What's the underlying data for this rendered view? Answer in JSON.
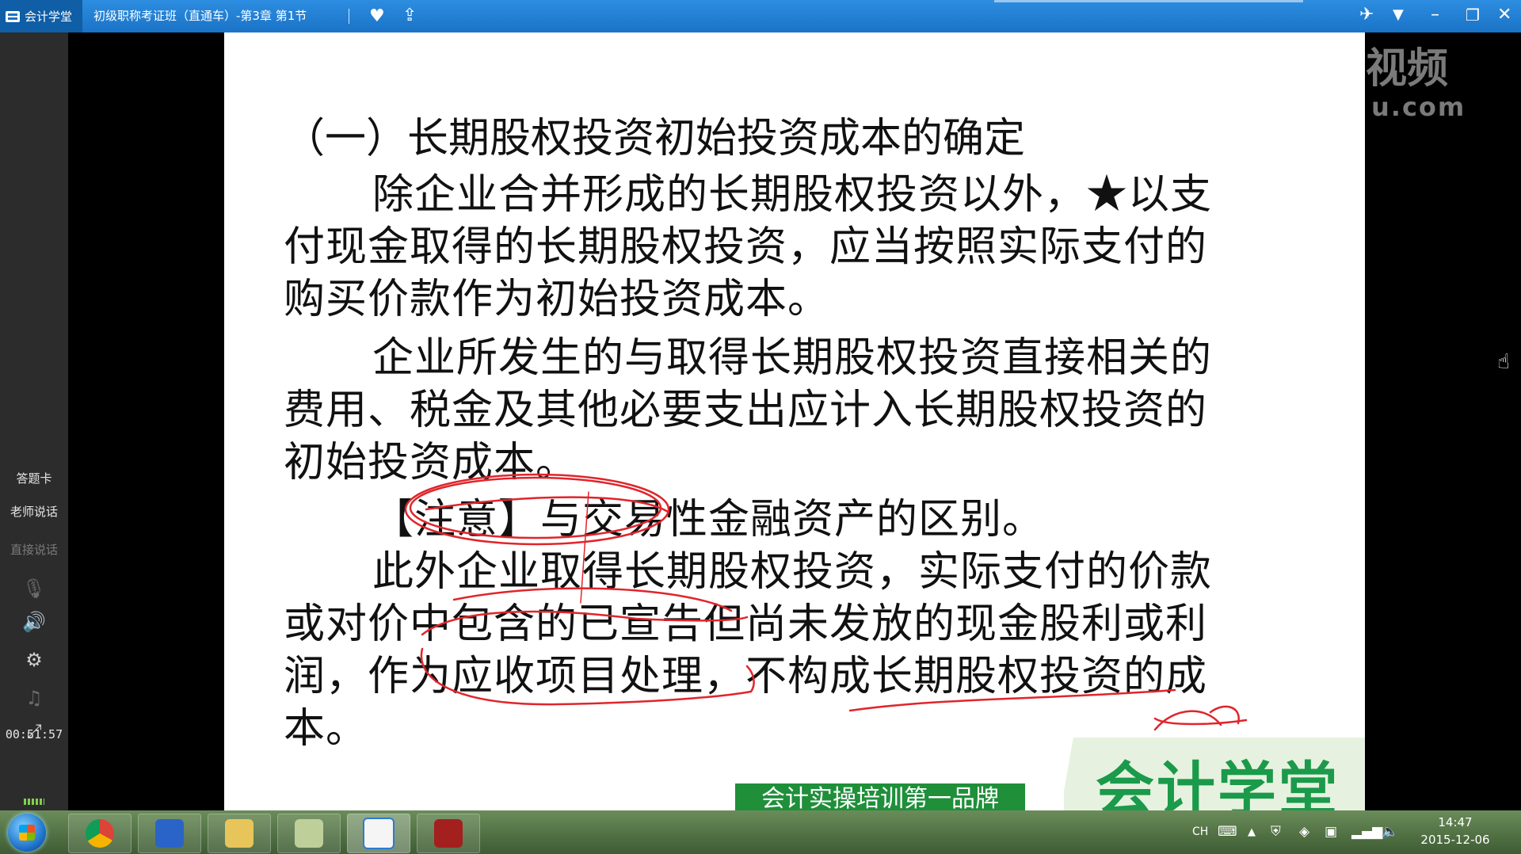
{
  "titlebar": {
    "app_name": "会计学堂",
    "window_title": "初级职称考证班（直通车）-第3章 第1节",
    "icons": [
      "heart-icon",
      "share-icon",
      "plane-icon",
      "chevron-down-icon",
      "minimize-icon",
      "restore-icon",
      "close-icon"
    ]
  },
  "sidebar": {
    "answer_card": "答题卡",
    "teacher_speaking": "老师说话",
    "direct_speaking": "直接说话",
    "timer": "00:51:57",
    "icons": [
      "mic-muted-icon",
      "speaker-icon",
      "gear-icon",
      "music-icon",
      "fullscreen-icon"
    ]
  },
  "slide": {
    "title": "（一）长期股权投资初始投资成本的确定",
    "para1": [
      "除企业合并形成的长期股权投资以外，★以支",
      "付现金取得的长期股权投资，应当按照实际支付的",
      "购买价款作为初始投资成本。"
    ],
    "para2": [
      "企业所发生的与取得长期股权投资直接相关的",
      "费用、税金及其他必要支出应计入长期股权投资的",
      "初始投资成本。"
    ],
    "note": "【注意】与交易性金融资产的区别。",
    "para3": [
      "此外企业取得长期股权投资，实际支付的价款",
      "或对价中包含的已宣告但尚未发放的现金股利或利",
      "润，作为应收项目处理，不构成长期股权投资的成",
      "本。"
    ],
    "banner": "会计实操培训第一品牌",
    "brand": "会计学堂"
  },
  "watermark": {
    "big": "视频",
    "small": "u.com"
  },
  "taskbar": {
    "lang": "CH",
    "time": "14:47",
    "date": "2015-12-06",
    "apps": [
      "chrome-icon",
      "explorer-icon",
      "folder-icon",
      "notes-icon",
      "kjxt-app-icon",
      "media-app-icon"
    ]
  }
}
